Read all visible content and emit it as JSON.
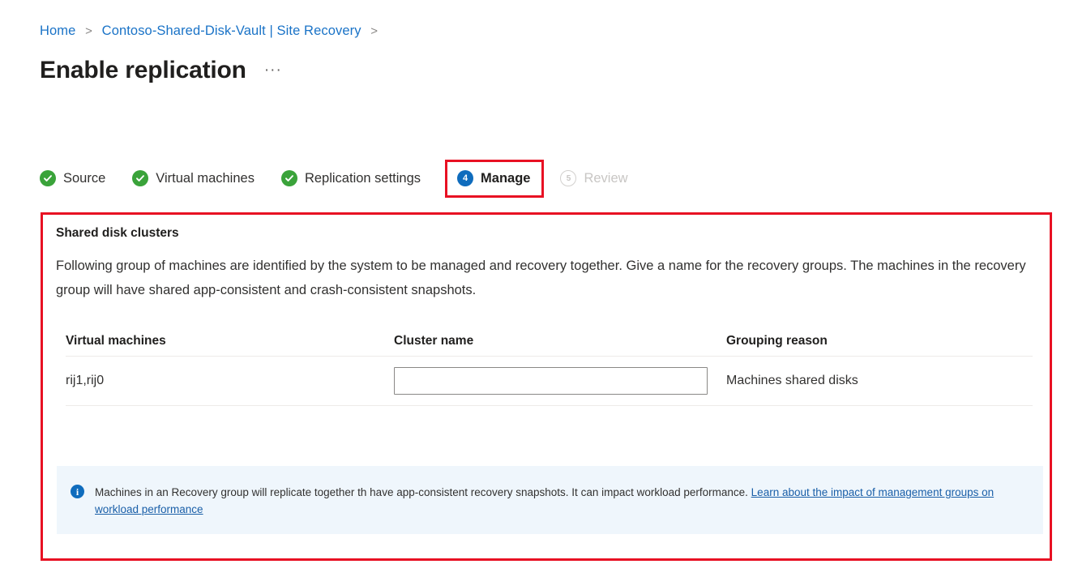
{
  "breadcrumb": {
    "items": [
      {
        "label": "Home"
      },
      {
        "label": "Contoso-Shared-Disk-Vault | Site Recovery"
      }
    ],
    "separator": ">"
  },
  "header": {
    "title": "Enable replication",
    "more_actions": "···"
  },
  "wizard": {
    "steps": [
      {
        "label": "Source",
        "state": "done",
        "marker": "✓"
      },
      {
        "label": "Virtual machines",
        "state": "done",
        "marker": "✓"
      },
      {
        "label": "Replication settings",
        "state": "done",
        "marker": "✓"
      },
      {
        "label": "Manage",
        "state": "current",
        "marker": "4"
      },
      {
        "label": "Review",
        "state": "pending",
        "marker": "5"
      }
    ]
  },
  "panel": {
    "section_title": "Shared disk clusters",
    "description": "Following group of machines are identified by the system to be managed and recovery together. Give a name for the recovery groups. The machines in the recovery group will have shared app-consistent and crash-consistent snapshots.",
    "table": {
      "headers": {
        "virtual_machines": "Virtual machines",
        "cluster_name": "Cluster name",
        "grouping_reason": "Grouping reason"
      },
      "rows": [
        {
          "virtual_machines": "rij1,rij0",
          "cluster_name_value": "",
          "cluster_name_placeholder": "",
          "grouping_reason": "Machines shared disks"
        }
      ]
    },
    "info": {
      "icon": "info-icon",
      "text": "Machines in an Recovery group will replicate together th have app-consistent recovery snapshots. It can impact workload performance. ",
      "link_text": "Learn about the impact of management groups on workload performance"
    }
  },
  "colors": {
    "highlight_red": "#e81123",
    "accent_blue": "#0f6cbd",
    "link_blue": "#1a73c7",
    "success_green": "#3aa33a",
    "info_background": "#eff6fc",
    "disabled_grey": "#c8c6c4"
  }
}
